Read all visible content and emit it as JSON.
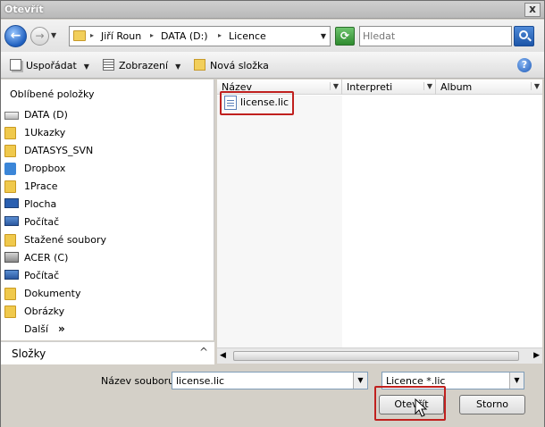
{
  "window": {
    "title": "Otevřít",
    "close_label": "x"
  },
  "address": {
    "back_glyph": "←",
    "forward_glyph": "→",
    "crumbs": [
      "Jiří Roun",
      "DATA (D:)",
      "Licence"
    ],
    "separator": "▸",
    "refresh_glyph": "⟳"
  },
  "search": {
    "placeholder": "Hledat"
  },
  "toolbar": {
    "organize_label": "Uspořádat",
    "views_label": "Zobrazení",
    "new_folder_label": "Nová složka",
    "help_glyph": "?"
  },
  "navpane": {
    "header": "Oblíbené položky",
    "items": [
      {
        "label": "DATA (D)",
        "icon": "drive-icon"
      },
      {
        "label": "1Ukazky",
        "icon": "folder-icon"
      },
      {
        "label": "DATASYS_SVN",
        "icon": "folder-icon"
      },
      {
        "label": "Dropbox",
        "icon": "dropbox-icon"
      },
      {
        "label": "1Prace",
        "icon": "folder-icon"
      },
      {
        "label": "Plocha",
        "icon": "desktop-icon"
      },
      {
        "label": "Počítač",
        "icon": "computer-icon"
      },
      {
        "label": "Stažené soubory",
        "icon": "folder-icon"
      },
      {
        "label": "ACER (C)",
        "icon": "acer-drive-icon"
      },
      {
        "label": "Počítač",
        "icon": "computer-icon"
      },
      {
        "label": "Dokumenty",
        "icon": "folder-icon"
      },
      {
        "label": "Obrázky",
        "icon": "folder-icon"
      },
      {
        "label": "Další",
        "icon": "none"
      }
    ],
    "more_glyph": "»",
    "folders_label": "Složky",
    "folders_chevron": "^"
  },
  "filelist": {
    "columns": [
      "Název",
      "Interpreti",
      "Album"
    ],
    "files": [
      {
        "name": "license.lic"
      }
    ]
  },
  "footer": {
    "filename_label": "Název souboru:",
    "filename_value": "license.lic",
    "filter_value": "Licence *.lic",
    "open_label": "Otevřít",
    "cancel_label": "Storno"
  },
  "colors": {
    "highlight": "#c0201e",
    "accent": "#1f5fbf"
  }
}
